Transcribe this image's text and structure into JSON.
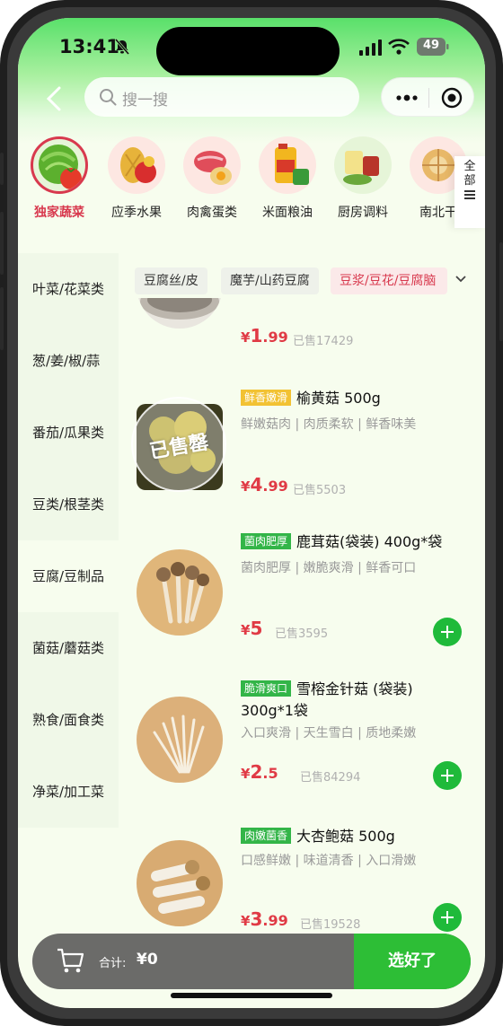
{
  "status_bar": {
    "time": "13:41",
    "battery": "49"
  },
  "search": {
    "placeholder": "搜一搜"
  },
  "categories": [
    {
      "label": "独家蔬菜",
      "active": true
    },
    {
      "label": "应季水果"
    },
    {
      "label": "肉禽蛋类"
    },
    {
      "label": "米面粮油"
    },
    {
      "label": "厨房调料"
    },
    {
      "label": "南北干"
    }
  ],
  "all_label": "全部",
  "side_nav": [
    {
      "label": "叶菜/花菜类"
    },
    {
      "label": "葱/姜/椒/蒜"
    },
    {
      "label": "番茄/瓜果类"
    },
    {
      "label": "豆类/根茎类"
    },
    {
      "label": "豆腐/豆制品",
      "active": true
    },
    {
      "label": "菌菇/蘑菇类"
    },
    {
      "label": "熟食/面食类"
    },
    {
      "label": "净菜/加工菜"
    }
  ],
  "sub_tabs": [
    {
      "label": "豆腐丝/皮"
    },
    {
      "label": "魔芋/山药豆腐"
    },
    {
      "label": "豆浆/豆花/豆腐脑",
      "active": true
    }
  ],
  "products": [
    {
      "price_yen": "¥",
      "price_int": "1",
      "price_dec": ".99",
      "sold": "已售17429"
    },
    {
      "tag": "鲜香嫩滑",
      "title": "榆黄菇 500g",
      "desc": "鲜嫩菇肉 | 肉质柔软 | 鲜香味美",
      "price_yen": "¥",
      "price_int": "4",
      "price_dec": ".99",
      "sold": "已售5503",
      "soldout_text": "已售罄"
    },
    {
      "tag": "菌肉肥厚",
      "title": "鹿茸菇(袋装) 400g*袋",
      "desc": "菌肉肥厚 | 嫩脆爽滑 | 鲜香可口",
      "price_yen": "¥",
      "price_int": "5",
      "price_dec": "",
      "sold": "已售3595"
    },
    {
      "tag": "脆滑爽口",
      "title": "雪榕金针菇 (袋装) 300g*1袋",
      "desc": "入口爽滑 | 天生雪白 | 质地柔嫩",
      "price_yen": "¥",
      "price_int": "2",
      "price_dec": ".5",
      "sold": "已售84294"
    },
    {
      "tag": "肉嫩菌香",
      "title": "大杏鲍菇 500g",
      "desc": "口感鲜嫩 | 味道清香 | 入口滑嫩",
      "price_yen": "¥",
      "price_int": "3",
      "price_dec": ".99",
      "sold": "已售19528"
    }
  ],
  "cart": {
    "total_label": "合计:",
    "total_value": "¥0",
    "checkout_label": "选好了"
  },
  "colors": {
    "accent_red": "#d8394e",
    "brand_green": "#2dbe36",
    "tag_gold": "#f2c233"
  },
  "icons": [
    "bell-off-icon",
    "signal-icon",
    "wifi-icon",
    "battery-icon",
    "back-icon",
    "search-icon",
    "more-icon",
    "target-icon",
    "list-icon",
    "dropdown-icon",
    "add-icon",
    "cart-icon"
  ]
}
